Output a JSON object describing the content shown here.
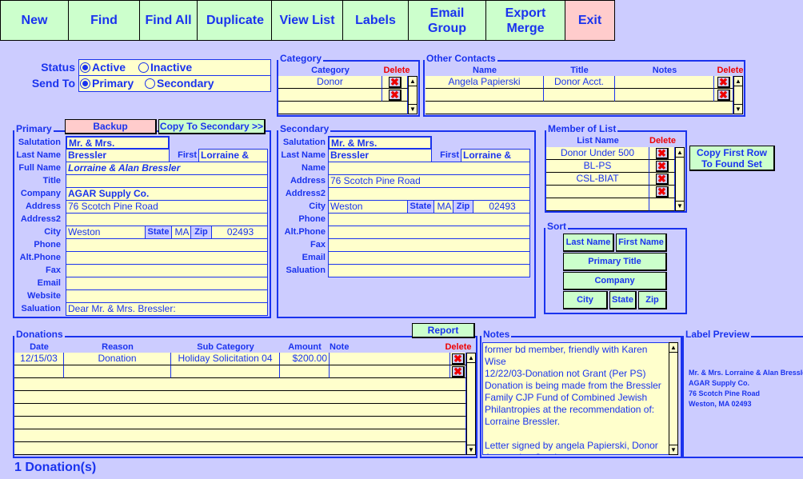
{
  "toolbar": [
    {
      "label": "New"
    },
    {
      "label": "Find"
    },
    {
      "label": "Find All"
    },
    {
      "label": "Duplicate"
    },
    {
      "label": "View List"
    },
    {
      "label": "Labels"
    },
    {
      "label": "Email Group"
    },
    {
      "label": "Export Merge"
    },
    {
      "label": "Exit"
    }
  ],
  "status": {
    "label": "Status",
    "options": [
      "Active",
      "Inactive"
    ],
    "selected": "Active"
  },
  "send_to": {
    "label": "Send To",
    "options": [
      "Primary",
      "Secondary"
    ],
    "selected": "Primary"
  },
  "category": {
    "title": "Category",
    "col_category": "Category",
    "col_delete": "Delete",
    "rows": [
      "Donor",
      ""
    ]
  },
  "other_contacts": {
    "title": "Other Contacts",
    "col_name": "Name",
    "col_title": "Title",
    "col_notes": "Notes",
    "col_delete": "Delete",
    "rows": [
      {
        "name": "Angela Papierski",
        "title": "Donor Acct.",
        "notes": ""
      },
      {
        "name": "",
        "title": "",
        "notes": ""
      }
    ]
  },
  "primary": {
    "title": "Primary",
    "backup_label": "Backup",
    "copy_label": "Copy To Secondary >>",
    "first_label": "First",
    "first": "Lorraine &",
    "state_label": "State",
    "zip_label": "Zip",
    "state": "MA",
    "zip": "02493",
    "fields": [
      {
        "label": "Salutation",
        "value": "Mr. & Mrs."
      },
      {
        "label": "Last Name",
        "value": "Bressler"
      },
      {
        "label": "Full Name",
        "value": "Lorraine &  Alan Bressler"
      },
      {
        "label": "Title",
        "value": ""
      },
      {
        "label": "Company",
        "value": "AGAR Supply Co."
      },
      {
        "label": "Address",
        "value": "76 Scotch Pine Road"
      },
      {
        "label": "Address2",
        "value": ""
      },
      {
        "label": "City",
        "value": "Weston"
      },
      {
        "label": "Phone",
        "value": ""
      },
      {
        "label": "Alt.Phone",
        "value": ""
      },
      {
        "label": "Fax",
        "value": ""
      },
      {
        "label": "Email",
        "value": ""
      },
      {
        "label": "Website",
        "value": ""
      },
      {
        "label": "Saluation",
        "value": "Dear Mr. & Mrs. Bressler:"
      }
    ]
  },
  "secondary": {
    "title": "Secondary",
    "first_label": "First",
    "first": "Lorraine &",
    "state_label": "State",
    "zip_label": "Zip",
    "state": "MA",
    "zip": "02493",
    "fields": [
      {
        "label": "Salutation",
        "value": "Mr. & Mrs."
      },
      {
        "label": "Last Name",
        "value": "Bressler"
      },
      {
        "label": "Name",
        "value": ""
      },
      {
        "label": "Address",
        "value": "76 Scotch Pine Road"
      },
      {
        "label": "Address2",
        "value": ""
      },
      {
        "label": "City",
        "value": "Weston"
      },
      {
        "label": "Phone",
        "value": ""
      },
      {
        "label": "Alt.Phone",
        "value": ""
      },
      {
        "label": "Fax",
        "value": ""
      },
      {
        "label": "Email",
        "value": ""
      },
      {
        "label": "Saluation",
        "value": ""
      }
    ]
  },
  "member_of_list": {
    "title": "Member of List",
    "col_list": "List Name",
    "col_delete": "Delete",
    "rows": [
      "Donor Under 500",
      "BL-PS",
      "CSL-BIAT",
      "",
      ""
    ],
    "copy_label": "Copy First Row To Found Set"
  },
  "sort": {
    "title": "Sort",
    "last_name": "Last Name",
    "first_name": "First Name",
    "primary_title": "Primary Title",
    "company": "Company",
    "city": "City",
    "state": "State",
    "zip": "Zip"
  },
  "donations": {
    "title": "Donations",
    "report_label": "Report",
    "cols": [
      "Date",
      "Reason",
      "Sub Category",
      "Amount",
      "Note",
      "Delete"
    ],
    "rows": [
      {
        "date": "12/15/03",
        "reason": "Donation",
        "sub": "Holiday Solicitation 04",
        "amount": "$200.00",
        "note": ""
      },
      {
        "date": "",
        "reason": "",
        "sub": "",
        "amount": "",
        "note": ""
      }
    ],
    "count_text": "1 Donation(s)"
  },
  "notes": {
    "title": "Notes",
    "text": "former bd member, friendly with Karen Wise\n12/22/03-Donation not Grant (Per PS)\nDonation is being made from the Bressler Family CJP Fund of Combined Jewish Philantropies at the recommendation of: Lorraine Bressler.\n\nLetter signed by angela Papierski, Donor Accounting Services"
  },
  "label_preview": {
    "title": "Label Preview",
    "lines": [
      "Mr. & Mrs. Lorraine & Alan Bressler",
      "AGAR Supply Co.",
      "76 Scotch Pine Road",
      "Weston, MA  02493"
    ]
  },
  "colors": {
    "background": "#ccccff",
    "field": "#ffffcc",
    "text": "#1a33ee",
    "button": "#ccffcc",
    "exit": "#ffcccc",
    "delete": "#ee0000"
  }
}
